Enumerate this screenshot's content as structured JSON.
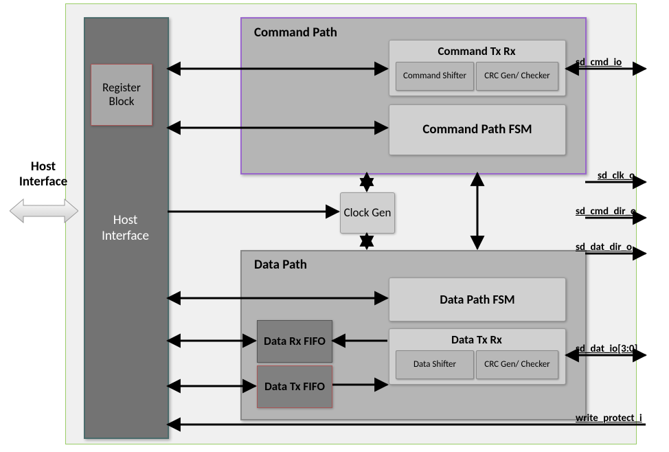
{
  "host_ext_label": "Host Interface",
  "host_block": {
    "register_block": "Register Block",
    "interface_label": "Host Interface"
  },
  "command_path": {
    "title": "Command Path",
    "txrx_title": "Command Tx Rx",
    "shifter": "Command Shifter",
    "crc": "CRC Gen/ Checker",
    "fsm": "Command Path FSM"
  },
  "clock_gen": "Clock Gen",
  "data_path": {
    "title": "Data Path",
    "rx_fifo": "Data Rx FIFO",
    "tx_fifo": "Data Tx FIFO",
    "fsm": "Data Path FSM",
    "txrx_title": "Data Tx Rx",
    "shifter": "Data Shifter",
    "crc": "CRC Gen/ Checker"
  },
  "signals": {
    "sd_cmd_io": "sd_cmd_io",
    "sd_clk_o": "sd_clk_o",
    "sd_cmd_dir_o": "sd_cmd_dir_o",
    "sd_dat_dir_o": "sd_dat_dir_o",
    "sd_dat_io": "sd_dat_io[3:0]",
    "write_protect_i": "write_protect_i"
  }
}
